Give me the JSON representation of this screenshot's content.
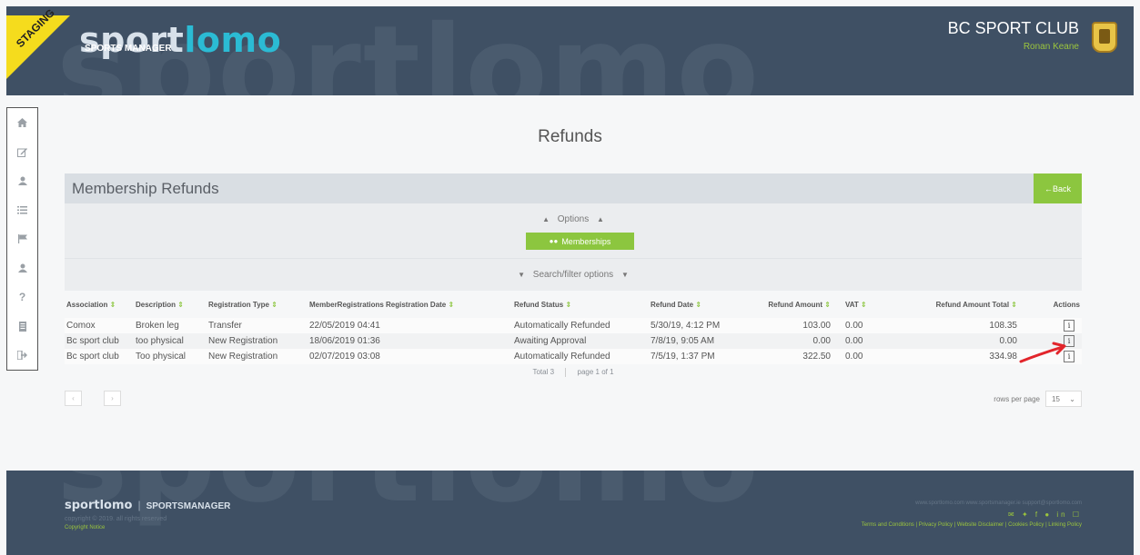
{
  "header": {
    "bg_word": "sportlomo",
    "staging": "STAGING",
    "logo_a": "sport",
    "logo_b": "lomo",
    "logo_sub": "SPORTS MANAGER",
    "club_name": "BC SPORT CLUB",
    "user_name": "Ronan Keane"
  },
  "sidebar": {
    "icons": [
      "home-icon",
      "edit-icon",
      "user-icon",
      "list-icon",
      "flag-icon",
      "user-icon",
      "help-icon",
      "document-icon",
      "logout-icon"
    ]
  },
  "page": {
    "title": "Refunds",
    "panel_title": "Membership Refunds",
    "back_label": "←Back",
    "options_label": "Options",
    "memberships_label": "Memberships",
    "filter_label": "Search/filter options"
  },
  "table": {
    "headers": [
      "Association",
      "Description",
      "Registration Type",
      "MemberRegistrations Registration Date",
      "Refund Status",
      "Refund Date",
      "Refund Amount",
      "VAT",
      "Refund Amount Total",
      "Actions"
    ],
    "rows": [
      [
        "Comox",
        "Broken leg",
        "Transfer",
        "22/05/2019 04:41",
        "Automatically Refunded",
        "5/30/19, 4:12 PM",
        "103.00",
        "0.00",
        "108.35"
      ],
      [
        "Bc sport club",
        "too physical",
        "New Registration",
        "18/06/2019 01:36",
        "Awaiting Approval",
        "7/8/19, 9:05 AM",
        "0.00",
        "0.00",
        "0.00"
      ],
      [
        "Bc sport club",
        "Too physical",
        "New Registration",
        "02/07/2019 03:08",
        "Automatically Refunded",
        "7/5/19, 1:37 PM",
        "322.50",
        "0.00",
        "334.98"
      ]
    ],
    "action_glyph": "i",
    "total_text": "Total 3",
    "page_text": "page 1 of 1",
    "rows_per_page_label": "rows per page",
    "rows_per_page_value": "15"
  },
  "footer": {
    "logo": "sportlomo",
    "logo_sub": "SPORTSMANAGER",
    "copyright": "copyright © 2019. all rights reserved",
    "notice": "Copyright Notice",
    "links": "www.sportlomo.com   www.sportsmanager.ie   support@sportlomo.com",
    "legal": "Terms and Conditions | Privacy Policy | Website Disclaimer | Cookies Policy | Linking Policy"
  },
  "colors": {
    "header_bg": "#3f5064",
    "accent_green": "#8cc63f",
    "logo_blue": "#2bbbd4",
    "staging_yellow": "#f5dc1d",
    "annotation_red": "#e2252b"
  }
}
